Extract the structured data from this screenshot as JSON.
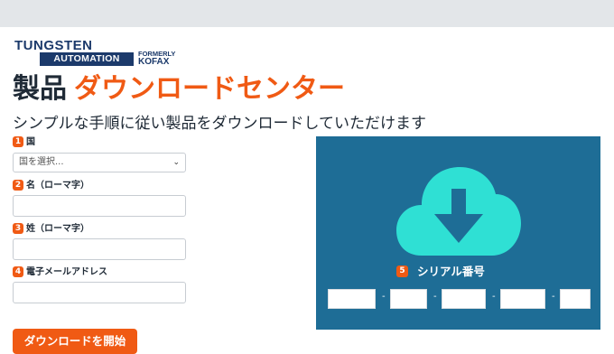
{
  "logo": {
    "tungsten": "TUNGSTEN",
    "automation": "AUTOMATION",
    "formerly": "FORMERLY",
    "kofax": "KOFAX"
  },
  "heading": {
    "part1": "製品",
    "part2": "ダウンロードセンター"
  },
  "subtitle": "シンプルな手順に従い製品をダウンロードしていただけます",
  "form": {
    "country": {
      "num": "1",
      "label": "国",
      "selected": "国を選択..."
    },
    "first_name": {
      "num": "2",
      "label": "名（ローマ字）",
      "value": ""
    },
    "last_name": {
      "num": "3",
      "label": "姓（ローマ字）",
      "value": ""
    },
    "email": {
      "num": "4",
      "label": "電子メールアドレス",
      "value": ""
    }
  },
  "download_button": "ダウンロードを開始",
  "serial": {
    "num": "5",
    "label": "シリアル番号",
    "separator": "-",
    "segments": [
      "",
      "",
      "",
      "",
      ""
    ]
  },
  "colors": {
    "accent": "#f05a14",
    "panel": "#1e6d96",
    "cloud": "#2fe0d4",
    "navy": "#1c3a6b"
  }
}
